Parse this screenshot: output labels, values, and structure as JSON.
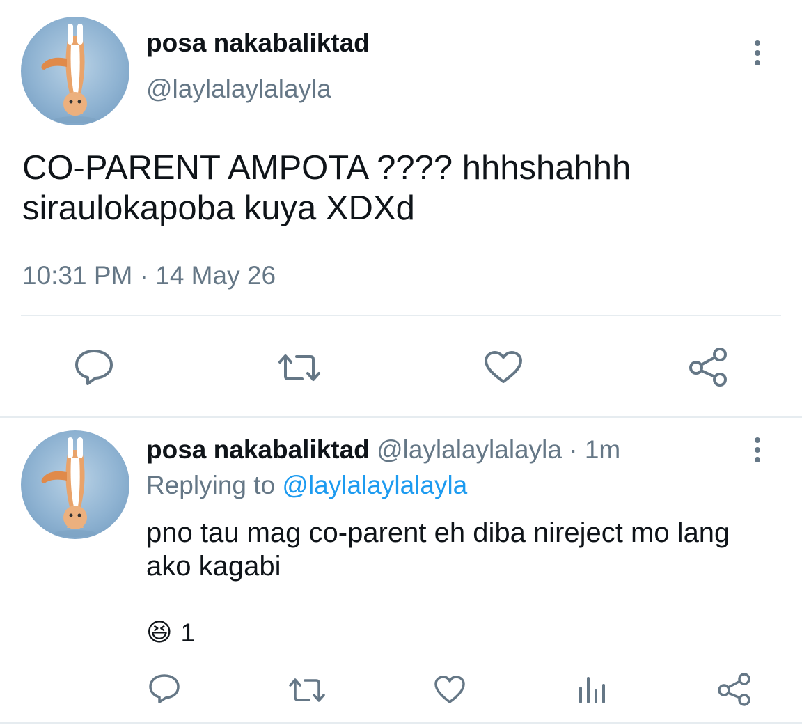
{
  "main_tweet": {
    "display_name": "posa nakabaliktad",
    "handle": "@laylalaylalayla",
    "text_line1": "CO-PARENT AMPOTA ???? hhhshahhh",
    "text_line2": "siraulokapoba kuya XDXd",
    "timestamp": "10:31 PM · 14 May 26",
    "actions": [
      "reply-icon",
      "retweet-icon",
      "like-icon",
      "share-icon"
    ]
  },
  "reply_tweet": {
    "display_name": "posa nakabaliktad",
    "handle": "@laylalaylalayla",
    "separator": "·",
    "time_ago": "1m",
    "replying_prefix": "Replying to",
    "replying_handle": "@laylalaylalayla",
    "text_line1": "pno tau mag co-parent eh diba nireject mo lang",
    "text_line2": "ako kagabi",
    "reaction_emoji": "😆",
    "reaction_count": "1",
    "actions": [
      "reply-icon",
      "retweet-icon",
      "like-icon",
      "analytics-icon",
      "share-icon"
    ]
  },
  "colors": {
    "text": "#0f1419",
    "muted": "#657786",
    "link": "#1d9bf0",
    "divider": "#e6ecf0"
  }
}
